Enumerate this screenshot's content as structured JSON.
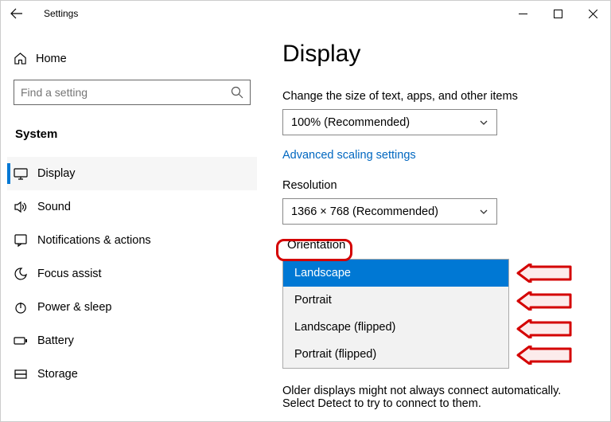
{
  "titlebar": {
    "label": "Settings"
  },
  "sidebar": {
    "home_label": "Home",
    "search_placeholder": "Find a setting",
    "category_label": "System",
    "items": [
      {
        "label": "Display"
      },
      {
        "label": "Sound"
      },
      {
        "label": "Notifications & actions"
      },
      {
        "label": "Focus assist"
      },
      {
        "label": "Power & sleep"
      },
      {
        "label": "Battery"
      },
      {
        "label": "Storage"
      }
    ]
  },
  "main": {
    "page_title": "Display",
    "scale_label": "Change the size of text, apps, and other items",
    "scale_value": "100% (Recommended)",
    "advanced_scaling": "Advanced scaling settings",
    "resolution_label": "Resolution",
    "resolution_value": "1366 × 768 (Recommended)",
    "orientation_label": "Orientation",
    "orientation_options": [
      "Landscape",
      "Portrait",
      "Landscape (flipped)",
      "Portrait (flipped)"
    ],
    "orientation_selected": "Landscape",
    "footer_text": "Older displays might not always connect automatically. Select Detect to try to connect to them."
  },
  "annotation": {
    "indicator_color": "#d40000"
  }
}
